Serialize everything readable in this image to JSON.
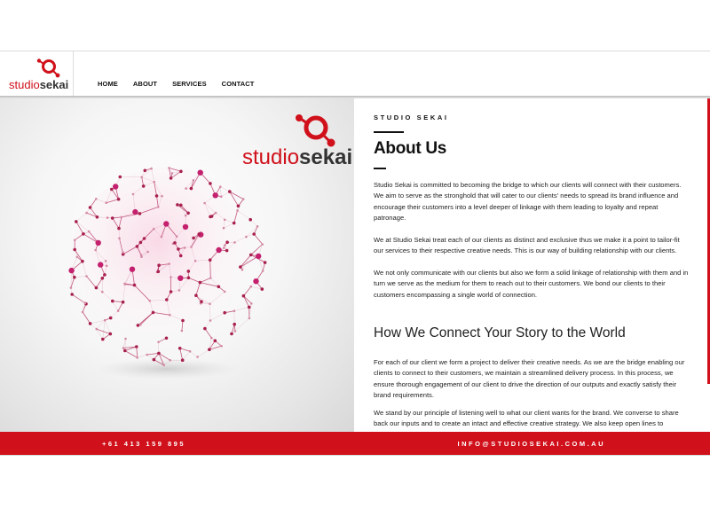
{
  "header": {
    "logo": {
      "word_light": "studio",
      "word_bold": "sekai"
    },
    "nav": [
      "HOME",
      "ABOUT",
      "SERVICES",
      "CONTACT"
    ]
  },
  "hero": {
    "logo": {
      "word_light": "studio",
      "word_bold": "sekai"
    },
    "image": "network-sphere"
  },
  "about": {
    "eyebrow": "STUDIO SEKAI",
    "title": "About Us",
    "paragraphs": [
      "Studio Sekai is committed to becoming the bridge to which our clients will connect with their customers. We aim to serve as the stronghold that will cater to our clients' needs to spread its brand influence and encourage their customers into a level deeper of linkage with them leading to loyalty and repeat patronage.",
      "We at Studio Sekai treat each of our clients as distinct and exclusive thus we make it a point to tailor-fit our services to their respective creative needs. This is our way of building relationship with our clients.",
      "We not only communicate with our clients but also we form a solid linkage of relationship with them and in turn we serve as the medium for them to reach out to their customers. We bond our clients to their customers encompassing a single world of connection."
    ],
    "subheading": "How We Connect Your Story to the World",
    "paragraphs2": [
      "For each of our client we form a project to deliver their creative needs. As we are the bridge enabling our clients to connect to their customers, we maintain a streamlined delivery process. In this process, we ensure thorough engagement of our client to drive the direction of our outputs and exactly satisfy their brand requirements.",
      "We stand by our principle of listening well to what our client wants for the brand. We converse to share back our inputs and to create an intact and effective creative strategy. We also keep open lines to"
    ]
  },
  "footer": {
    "phone": "+61 413 159 895",
    "email": "INFO@STUDIOSEKAI.COM.AU"
  },
  "colors": {
    "accent": "#d0101a",
    "dark": "#222222"
  }
}
